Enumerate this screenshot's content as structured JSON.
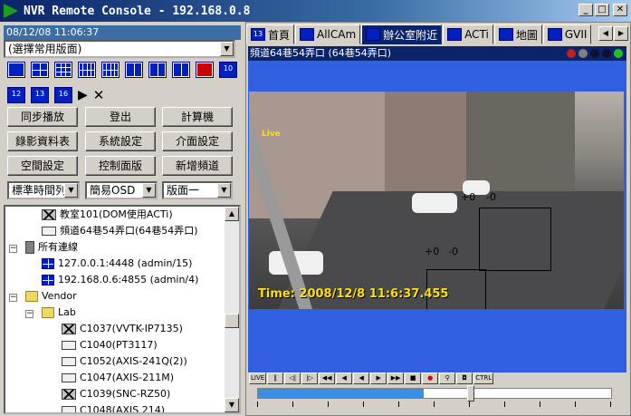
{
  "window": {
    "title": "NVR Remote Console - 192.168.0.8"
  },
  "left": {
    "datetime": "08/12/08 11:06:37",
    "layout_select": "(選擇常用版面)",
    "buttons": {
      "sync_play": "同步播放",
      "logout": "登出",
      "calculator": "計算機",
      "rec_table": "錄影資料表",
      "sys_settings": "系統設定",
      "ui_settings": "介面設定",
      "space_settings": "空間設定",
      "control_panel": "控制面版",
      "add_channel": "新增頻道"
    },
    "selects": {
      "time_format": "標準時間列",
      "osd": "簡易OSD",
      "layout": "版面一"
    },
    "layout_icons": {
      "r2_1": "12",
      "r2_2": "13",
      "r2_3": "16",
      "r1_10": "10"
    },
    "tree": [
      {
        "label": "教室101(DOM使用ACTi)"
      },
      {
        "label": "頻道64巷54弄口(64巷54弄口)"
      },
      {
        "label": "所有連線"
      },
      {
        "label": "127.0.0.1:4448 (admin/15)"
      },
      {
        "label": "192.168.0.6:4855 (admin/4)"
      },
      {
        "label": "Vendor"
      },
      {
        "label": "Lab"
      },
      {
        "label": "C1037(VVTK-IP7135)"
      },
      {
        "label": "C1040(PT3117)"
      },
      {
        "label": "C1052(AXIS-241Q(2))"
      },
      {
        "label": "C1047(AXIS-211M)"
      },
      {
        "label": "C1039(SNC-RZ50)"
      },
      {
        "label": "C1048(AXIS 214)"
      }
    ]
  },
  "right": {
    "tabs": [
      {
        "label": "首頁",
        "icon": "13"
      },
      {
        "label": "AllCAm",
        "icon": ""
      },
      {
        "label": "辦公室附近",
        "icon": ""
      },
      {
        "label": "ACTi",
        "icon": ""
      },
      {
        "label": "地圖",
        "icon": ""
      },
      {
        "label": "GVII",
        "icon": ""
      }
    ],
    "channel_title": "頻道64巷54弄口 (64巷54弄口)",
    "video": {
      "live": "Live",
      "timestamp": "Time: 2008/12/8 11:6:37.455",
      "motion_labels": [
        "+0",
        "-0",
        "+0",
        "-0"
      ]
    },
    "playback": {
      "live": "LIVE",
      "ctrl": "CTRL"
    },
    "slider_progress": 0.47
  }
}
